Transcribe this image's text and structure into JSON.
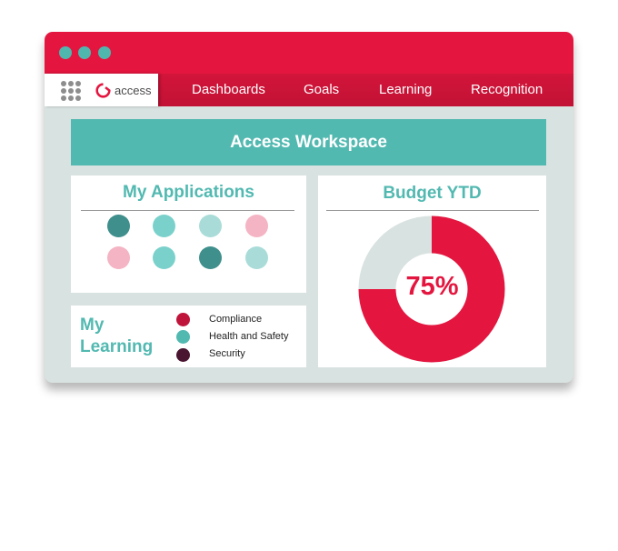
{
  "window": {
    "controls": [
      {
        "name": "window-control-dot",
        "color": "#4fb7ae"
      },
      {
        "name": "window-control-dot",
        "color": "#4fb7ae"
      },
      {
        "name": "window-control-dot",
        "color": "#4fb7ae"
      }
    ]
  },
  "header": {
    "apps_icon": "apps-grid-icon",
    "logo_icon": "access-logo-icon",
    "logo_text": "access",
    "nav": [
      {
        "label": "Dashboards"
      },
      {
        "label": "Goals"
      },
      {
        "label": "Learning"
      },
      {
        "label": "Recognition"
      }
    ]
  },
  "banner": {
    "title": "Access Workspace"
  },
  "applications": {
    "title": "My Applications",
    "apps": [
      {
        "color": "#3f8f8c"
      },
      {
        "color": "#7ad1cb"
      },
      {
        "color": "#a9dcd8"
      },
      {
        "color": "#f4b4c4"
      },
      {
        "color": "#f4b4c4"
      },
      {
        "color": "#7ad1cb"
      },
      {
        "color": "#3f8f8c"
      },
      {
        "color": "#a9dcd8"
      }
    ]
  },
  "learning": {
    "title": "My Learning",
    "items": [
      {
        "label": "Compliance",
        "color": "#c0153b"
      },
      {
        "label": "Health and Safety",
        "color": "#52b9b1"
      },
      {
        "label": "Security",
        "color": "#4a1530"
      }
    ]
  },
  "budget": {
    "title": "Budget YTD",
    "percent_label": "75%",
    "percent": 75,
    "fill_color": "#e4163f",
    "track_color": "#d8e2e0"
  },
  "colors": {
    "brand_red": "#e4163f",
    "teal": "#52b9b1",
    "background": "#d8e2e0"
  }
}
